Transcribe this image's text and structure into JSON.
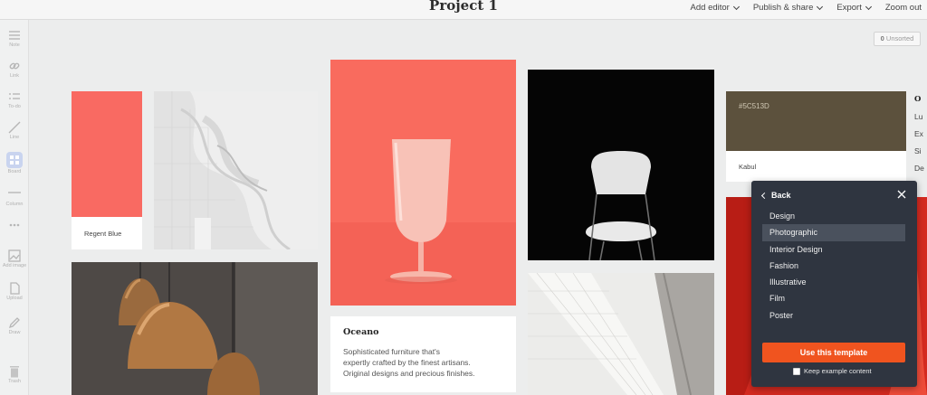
{
  "header": {
    "title": "Project 1",
    "menu": [
      {
        "label": "Add editor"
      },
      {
        "label": "Publish & share"
      },
      {
        "label": "Export"
      },
      {
        "label": "Zoom out"
      }
    ]
  },
  "toolbar": {
    "items": [
      {
        "label": "Note",
        "icon": "note-icon"
      },
      {
        "label": "Link",
        "icon": "link-icon"
      },
      {
        "label": "To-do",
        "icon": "todo-icon"
      },
      {
        "label": "Line",
        "icon": "line-icon"
      },
      {
        "label": "Board",
        "icon": "board-icon"
      },
      {
        "label": "Column",
        "icon": "column-icon"
      },
      {
        "label": "",
        "icon": "more-icon"
      },
      {
        "label": "Add image",
        "icon": "image-icon"
      },
      {
        "label": "Upload",
        "icon": "upload-icon"
      },
      {
        "label": "Draw",
        "icon": "pen-icon"
      },
      {
        "label": "Trash",
        "icon": "trash-icon"
      }
    ]
  },
  "unsorted": {
    "count": "0",
    "label": "Unsorted"
  },
  "cards": {
    "regent": {
      "label": "Regent Blue",
      "color": "#F96A62"
    },
    "kabul": {
      "hex": "#5C513D",
      "label": "Kabul"
    },
    "oceano": {
      "title": "Oceano",
      "lines": [
        "Sophisticated furniture that's",
        "expertly crafted by the finest artisans.",
        "Original designs and precious finishes."
      ]
    },
    "text_column": {
      "lines": [
        "O",
        "Lu",
        "Ex",
        "Si",
        "De"
      ]
    }
  },
  "template_panel": {
    "back_label": "Back",
    "items": [
      "Design",
      "Photographic",
      "Interior Design",
      "Fashion",
      "Illustrative",
      "Film",
      "Poster"
    ],
    "selected": "Photographic",
    "use_button": "Use this template",
    "keep_label": "Keep example content",
    "accent": "#F0541F"
  }
}
